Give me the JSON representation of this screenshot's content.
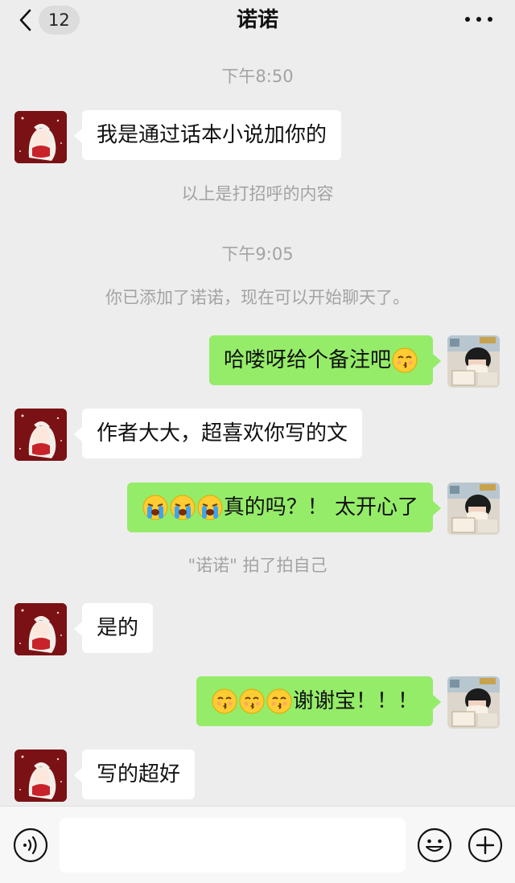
{
  "header": {
    "unread_count": "12",
    "title": "诺诺",
    "back_icon": "chevron-left-icon",
    "more_icon": "more-dots-icon"
  },
  "messages": [
    {
      "kind": "time",
      "text": "下午8:50"
    },
    {
      "kind": "incoming",
      "text": "我是通过话本小说加你的"
    },
    {
      "kind": "system",
      "text": "以上是打招呼的内容"
    },
    {
      "kind": "time",
      "text": "下午9:05"
    },
    {
      "kind": "system",
      "text": "你已添加了诺诺，现在可以开始聊天了。"
    },
    {
      "kind": "outgoing",
      "text": "哈喽呀给个备注吧",
      "emoji_after": [
        "kissing-smiling-eyes"
      ]
    },
    {
      "kind": "incoming",
      "text": "作者大大，超喜欢你写的文"
    },
    {
      "kind": "outgoing",
      "text": "真的吗？！ 太开心了",
      "emoji_before": [
        "loudly-crying",
        "loudly-crying",
        "loudly-crying"
      ]
    },
    {
      "kind": "system",
      "text": "\"诺诺\" 拍了拍自己"
    },
    {
      "kind": "incoming",
      "text": "是的"
    },
    {
      "kind": "outgoing",
      "text": "谢谢宝！！！",
      "emoji_before": [
        "kissing-smiling-eyes",
        "kissing-smiling-eyes",
        "kissing-smiling-eyes"
      ]
    },
    {
      "kind": "incoming",
      "text": "写的超好"
    }
  ],
  "footer": {
    "voice_icon": "voice-icon",
    "input_value": "",
    "emoji_icon": "smiley-face-icon",
    "plus_icon": "plus-icon"
  },
  "colors": {
    "background": "#ededed",
    "outgoing_bubble": "#95ec69",
    "incoming_bubble": "#ffffff",
    "system_text": "#a3a3a3"
  }
}
